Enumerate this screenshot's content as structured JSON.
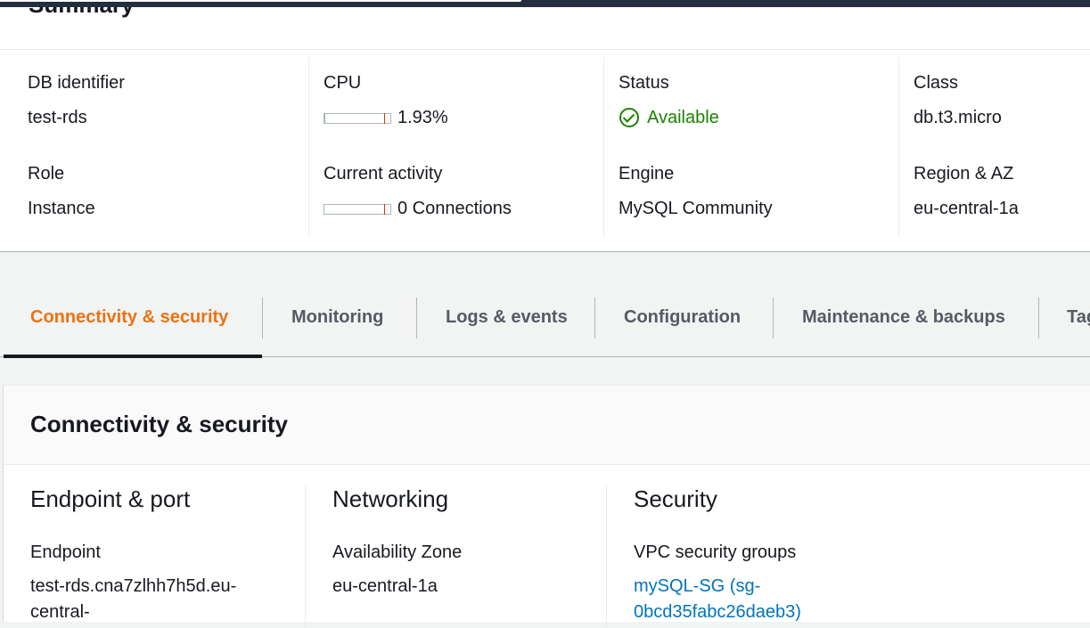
{
  "summary": {
    "title": "Summary",
    "db_identifier": {
      "label": "DB identifier",
      "value": "test-rds"
    },
    "cpu": {
      "label": "CPU",
      "value": "1.93%",
      "percent": 1.93
    },
    "status": {
      "label": "Status",
      "value": "Available",
      "icon": "check-circle-icon",
      "color": "#1d8102"
    },
    "class": {
      "label": "Class",
      "value": "db.t3.micro"
    },
    "role": {
      "label": "Role",
      "value": "Instance"
    },
    "current_activity": {
      "label": "Current activity",
      "value": "0 Connections",
      "connections": 0
    },
    "engine": {
      "label": "Engine",
      "value": "MySQL Community"
    },
    "region": {
      "label": "Region & AZ",
      "value": "eu-central-1a"
    }
  },
  "tabs": {
    "active_color": "#ec7211",
    "items": [
      {
        "label": "Connectivity & security",
        "active": true
      },
      {
        "label": "Monitoring"
      },
      {
        "label": "Logs & events"
      },
      {
        "label": "Configuration"
      },
      {
        "label": "Maintenance & backups"
      },
      {
        "label": "Tags"
      }
    ]
  },
  "connectivity": {
    "title": "Connectivity & security",
    "endpoint_port": {
      "title": "Endpoint & port",
      "endpoint_label": "Endpoint",
      "endpoint_line1": "test-rds.cna7zlhh7h5d.eu-",
      "endpoint_line2": "central-"
    },
    "networking": {
      "title": "Networking",
      "az_label": "Availability Zone",
      "az_value": "eu-central-1a"
    },
    "security": {
      "title": "Security",
      "vpc_sg_label": "VPC security groups",
      "vpc_sg_line1": "mySQL-SG (sg-",
      "vpc_sg_line2": "0bcd35fabc26daeb3)"
    }
  },
  "colors": {
    "link": "#0073bb",
    "available": "#1d8102",
    "tab_active": "#ec7211"
  }
}
